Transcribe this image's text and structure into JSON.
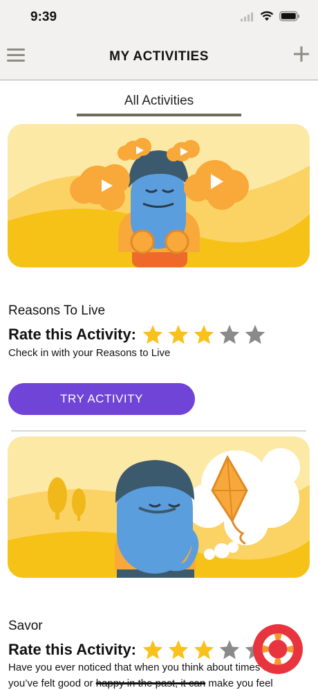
{
  "status_bar": {
    "time": "9:39"
  },
  "nav": {
    "title": "MY ACTIVITIES",
    "menu_icon": "hamburger-icon",
    "add_icon": "plus-icon"
  },
  "tabs": [
    {
      "label": "All Activities",
      "active": true
    }
  ],
  "colors": {
    "accent": "#6f44d6",
    "tab_underline": "#6d6a56",
    "star_filled": "#f9c21a",
    "star_empty": "#8a8a8a",
    "help": "#e8343f"
  },
  "activities": [
    {
      "title": "Reasons To Live",
      "rate_label": "Rate this Activity:",
      "rating": 3,
      "max_rating": 5,
      "description": "Check in with your Reasons to Live",
      "button": "TRY ACTIVITY"
    },
    {
      "title": "Savor",
      "rate_label": "Rate this Activity:",
      "rating": 3,
      "max_rating": 5,
      "description_line1": "Have you ever noticed that when you think about times when",
      "description_line2_a": "you’ve felt good or ",
      "description_line2_strike": "happy in the past, it can",
      "description_line2_b": " make you feel"
    }
  ],
  "help_button": {
    "icon": "lifebuoy-icon"
  }
}
